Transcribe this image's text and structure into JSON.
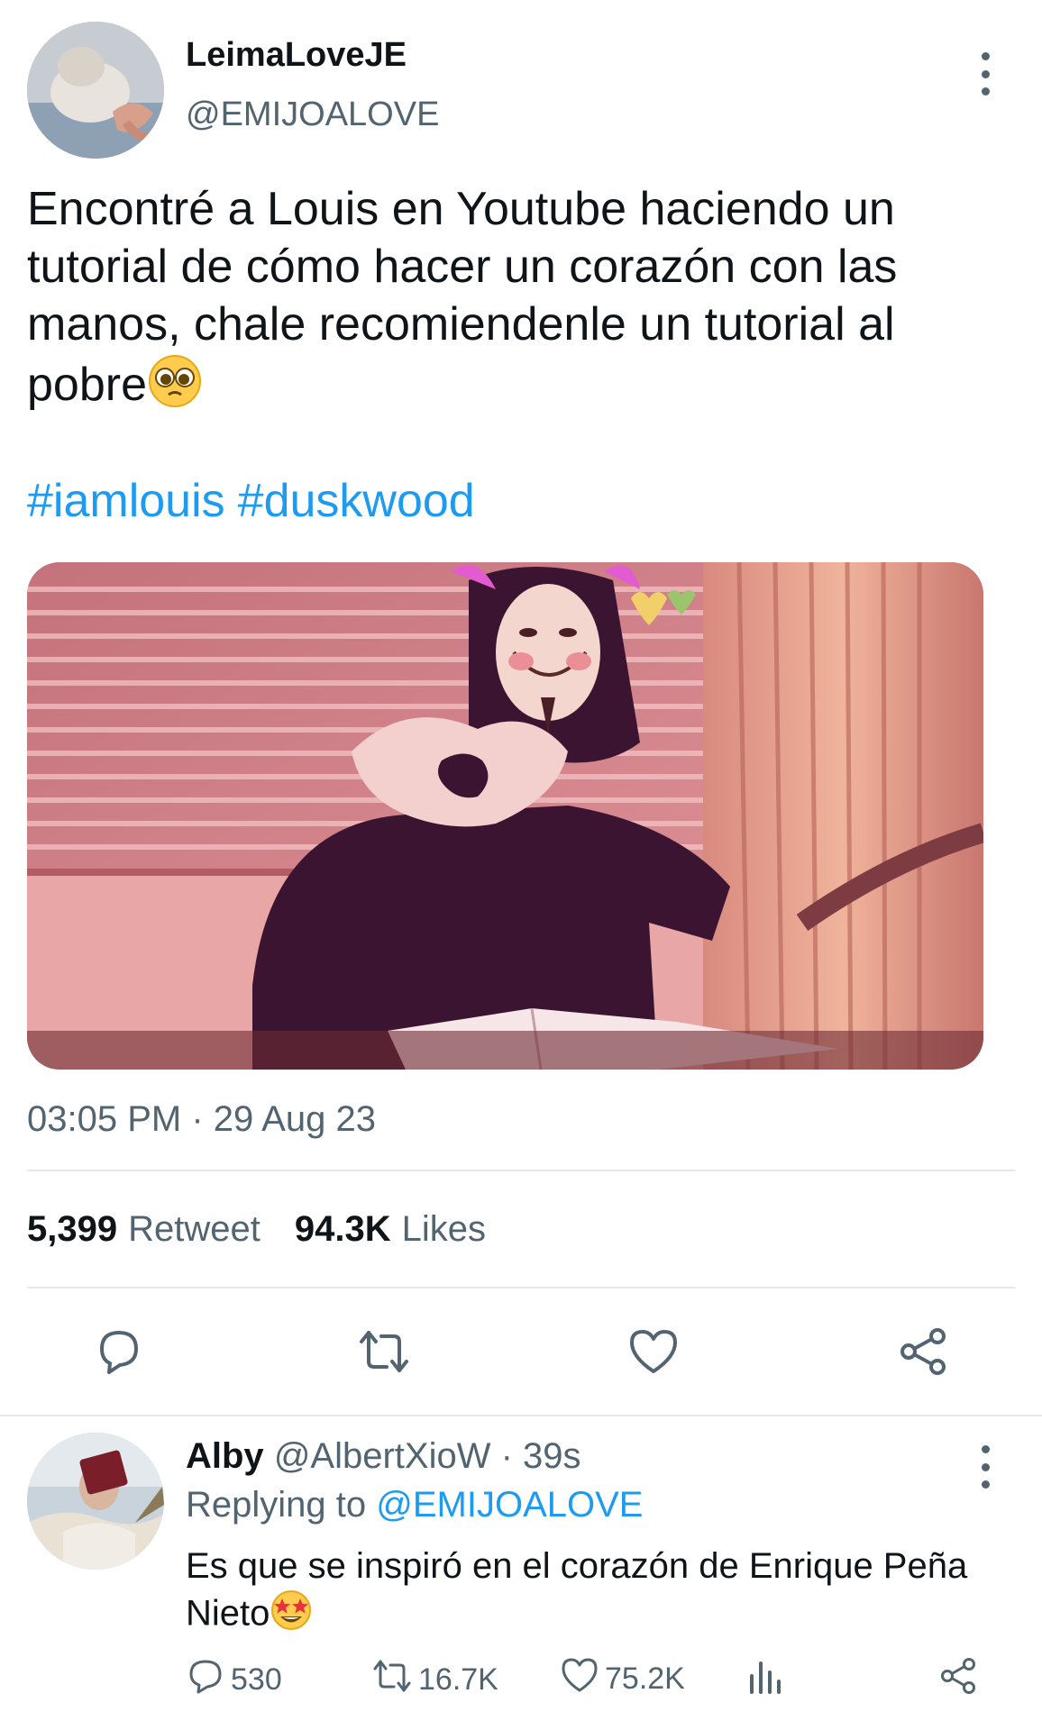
{
  "tweet": {
    "display_name": "LeimaLoveJE",
    "handle": "@EMIJOALOVE",
    "text": "Encontré a Louis en Youtube haciendo un tutorial de cómo hacer un corazón con las manos, chale recomiendenle un tutorial al pobre",
    "hashtags": [
      "#iamlouis",
      "#duskwood"
    ],
    "timestamp": "03:05 PM · 29 Aug 23",
    "stats": {
      "retweets": "5,399",
      "retweets_label": "Retweet",
      "likes": "94.3K",
      "likes_label": "Likes"
    },
    "emoji": "pleading-face"
  },
  "actions": [
    "reply-icon",
    "retweet-icon",
    "like-icon",
    "share-icon"
  ],
  "reply": {
    "display_name": "Alby",
    "handle": "@AlbertXioW",
    "time": "· 39s",
    "replying_label": "Replying to",
    "replying_to": "@EMIJOALOVE",
    "text": "Es que se inspiró en el corazón de Enrique Peña Nieto",
    "emoji": "star-struck",
    "counts": {
      "replies": "530",
      "retweets": "16.7K",
      "likes": "75.2K"
    }
  },
  "colors": {
    "accent": "#1d9bf0",
    "secondary_text": "#536471",
    "divider": "#e6e9ec"
  }
}
